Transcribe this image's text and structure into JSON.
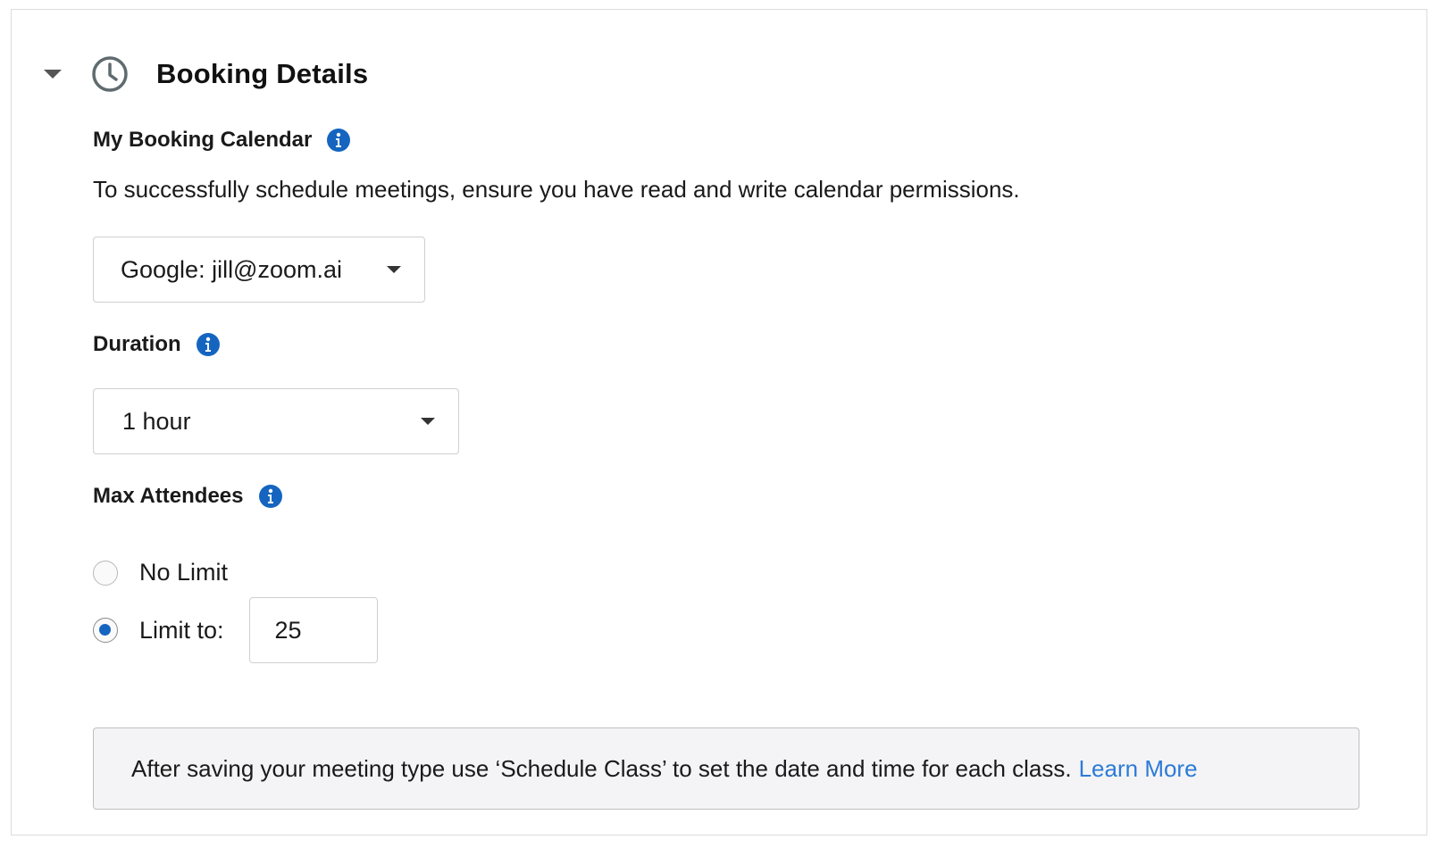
{
  "section": {
    "title": "Booking Details",
    "icon": "clock-icon",
    "expanded": true
  },
  "calendar": {
    "label": "My Booking Calendar",
    "help": "To successfully schedule meetings, ensure you have read and write calendar permissions.",
    "selected": "Google: jill@zoom.ai"
  },
  "duration": {
    "label": "Duration",
    "selected": "1 hour"
  },
  "attendees": {
    "label": "Max Attendees",
    "options": {
      "no_limit": "No Limit",
      "limit_to": "Limit to:"
    },
    "selected_option": "limit_to",
    "limit_value": "25"
  },
  "notice": {
    "text": "After saving your meeting type use ‘Schedule Class’ to set the date and time for each class.",
    "link": "Learn More"
  },
  "colors": {
    "accent": "#1565c0",
    "link": "#2d7bd6",
    "icon_gray": "#5f6b6f"
  }
}
